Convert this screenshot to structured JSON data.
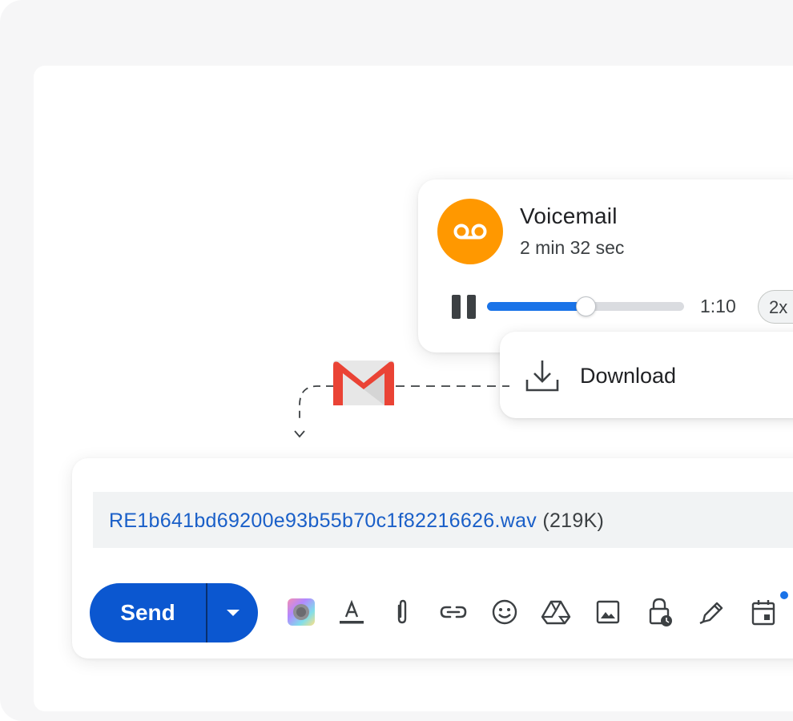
{
  "voicemail": {
    "title": "Voicemail",
    "duration": "2 min 32 sec",
    "current_time": "1:10",
    "speed": "2x",
    "progress_fraction": 0.5,
    "avatar_color": "#ff9800",
    "avatar_icon": "voicemail-icon"
  },
  "download_menu": {
    "label": "Download",
    "icon": "download-icon"
  },
  "compose": {
    "attachment_name": "RE1b641bd69200e93b55b70c1f82216626.wav",
    "attachment_size": "(219K)",
    "send_label": "Send",
    "toolbar_icons": [
      "ai-assist-icon",
      "text-format-icon",
      "attach-file-icon",
      "insert-link-icon",
      "emoji-icon",
      "drive-icon",
      "insert-photo-icon",
      "confidential-mode-icon",
      "signature-icon",
      "schedule-icon"
    ]
  },
  "colors": {
    "accent": "#0b57d0",
    "progress": "#1a73e8",
    "link": "#1a5fc8"
  }
}
